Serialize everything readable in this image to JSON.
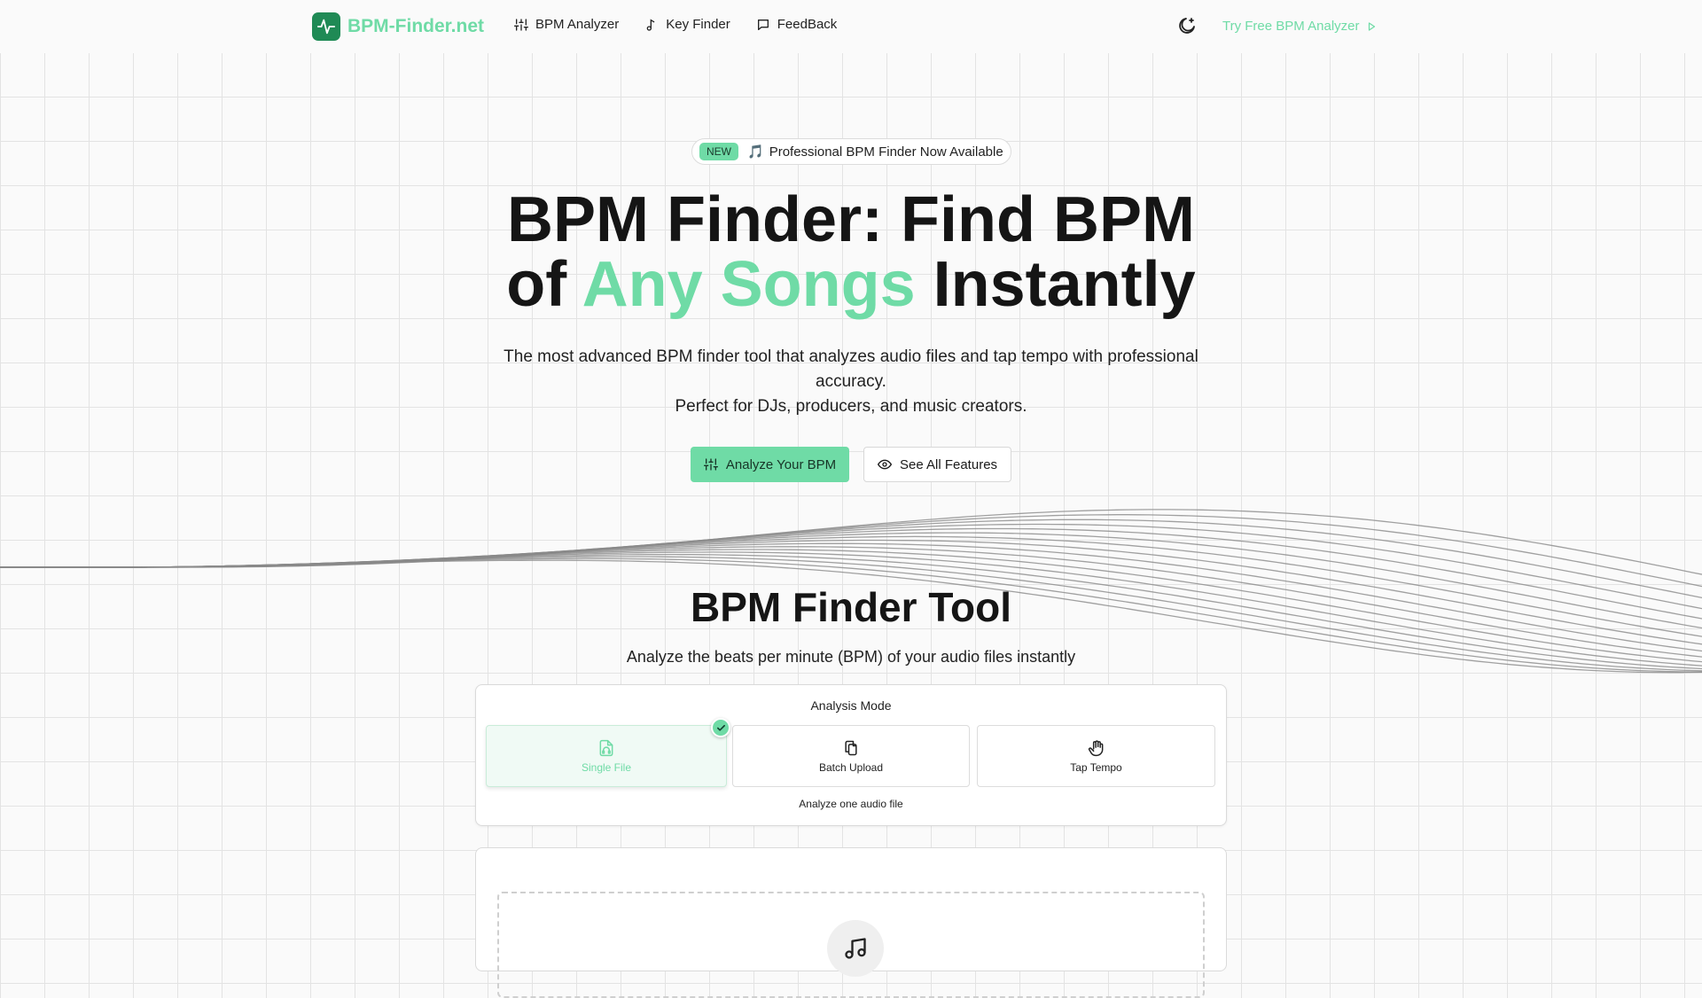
{
  "header": {
    "logo_text": "BPM-Finder.net",
    "logo_icon": "pulse-icon",
    "nav": [
      {
        "label": "BPM Analyzer",
        "icon": "sliders-icon"
      },
      {
        "label": "Key Finder",
        "icon": "music-note-icon"
      },
      {
        "label": "FeedBack",
        "icon": "message-icon"
      }
    ],
    "theme_icon": "moon-star-icon",
    "cta_label": "Try Free BPM Analyzer",
    "cta_icon": "play-icon"
  },
  "hero": {
    "badge": "NEW",
    "announcement_emoji": "🎵",
    "announcement": "Professional BPM Finder Now Available",
    "title_line1": "BPM Finder: Find BPM",
    "title_of": "of ",
    "title_accent": "Any Songs",
    "title_end": " Instantly",
    "subtitle_line1": "The most advanced BPM finder tool that analyzes audio files and tap tempo with professional accuracy.",
    "subtitle_line2": "Perfect for DJs, producers, and music creators.",
    "primary_button": "Analyze Your BPM",
    "secondary_button": "See All Features"
  },
  "tool": {
    "title": "BPM Finder Tool",
    "subtitle": "Analyze the beats per minute (BPM) of your audio files instantly",
    "mode_label": "Analysis Mode",
    "modes": [
      {
        "label": "Single File",
        "icon": "file-audio-icon",
        "selected": true
      },
      {
        "label": "Batch Upload",
        "icon": "files-icon",
        "selected": false
      },
      {
        "label": "Tap Tempo",
        "icon": "hand-icon",
        "selected": false
      }
    ],
    "mode_description": "Analyze one audio file"
  },
  "colors": {
    "accent": "#6fdba6",
    "logo_bg": "#1f8a55",
    "text": "#151515",
    "wave": "#8a8a8a"
  }
}
